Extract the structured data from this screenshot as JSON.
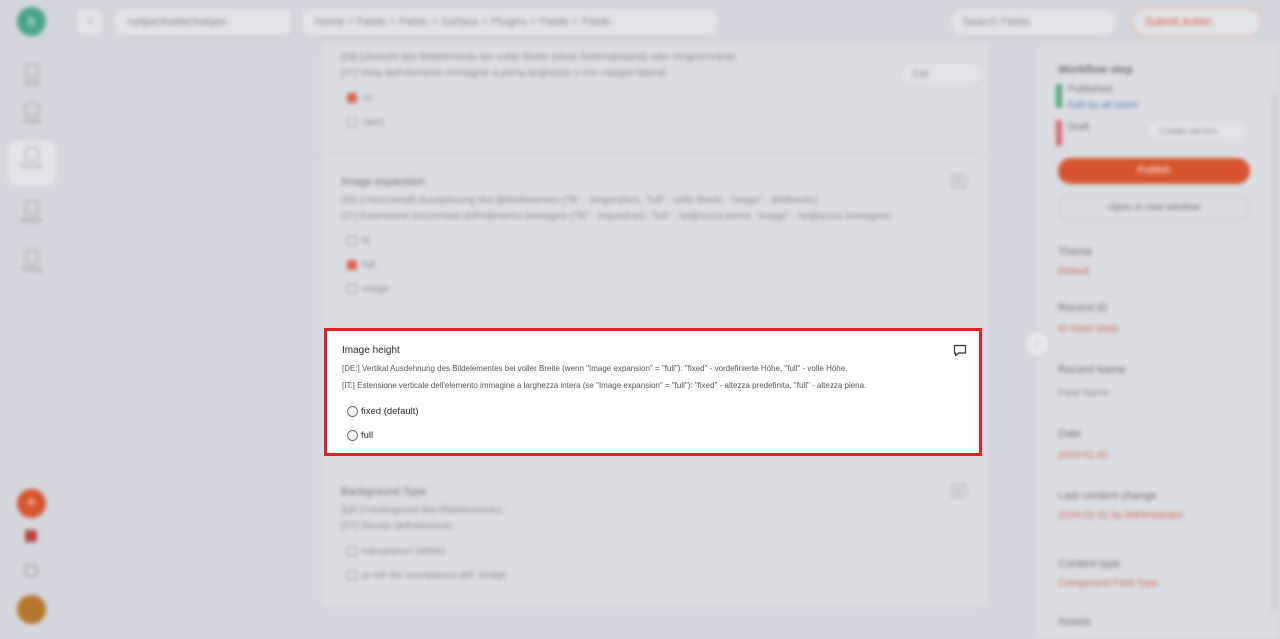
{
  "app": {
    "logo_text": "h",
    "breadcrumb_project": "neitperthattechatges",
    "breadcrumb_path": "Home > Fields > Fields > Surface > Plugins > Fields > Fields",
    "search_placeholder": "Search Fields",
    "top_right_button": "Submit Action"
  },
  "rail": {
    "items": [
      {
        "label": "Home"
      },
      {
        "label": "Assets"
      },
      {
        "label": "Records"
      },
      {
        "label": "Reports"
      },
      {
        "label": "Settings"
      }
    ],
    "avatar_initials": "R"
  },
  "background_fields": [
    {
      "desc_de": "[DE:] Ansicht des Bildelements bei voller Breite (ohne Seitenabstand) oder eingeschränkt",
      "desc_it": "[IT:] Vista dell'elemento immagine a piena larghezza o con margini laterali",
      "action_label": "Edit",
      "options": [
        {
          "label": "on",
          "checked": true
        },
        {
          "label": "open",
          "checked": false
        }
      ]
    },
    {
      "title": "Image expansion",
      "desc_de": "[DE:] Horizontale Ausdehnung des Bildelementes (\"fit\" - eingerahmt, \"full\" - volle Breite, \"image\" - Bildbreite)",
      "desc_it": "[IT:] Estensione orizzontale dell'elemento immagine (\"fit\" - inquadrato, \"full\" - larghezza piena, \"image\" - larghezza immagine)",
      "options": [
        {
          "label": "fit",
          "checked": false
        },
        {
          "label": "full",
          "checked": true
        },
        {
          "label": "image",
          "checked": false
        }
      ]
    },
    {
      "title": "Background Type",
      "desc_de": "[DE:] Hintergrund des Bildelementes",
      "desc_it": "[IT:] Sfondo dell'elemento",
      "options": [
        {
          "label": "transparent (white)",
          "checked": false
        },
        {
          "label": "ja mit der transparent def. Image",
          "checked": false
        }
      ]
    }
  ],
  "focus_field": {
    "title": "Image height",
    "desc_de": "[DE:] Vertikal Ausdehnung des Bildelementes bei voller Breite (wenn \"Image expansion\" = \"full\"): \"fixed\" - vordefinierte Höhe, \"full\" - volle Höhe.",
    "desc_it": "[IT:] Estensione verticale dell'elemento immagine a larghezza intera (se \"Image expansion\" = \"full\"): \"fixed\" - altezza predefinita, \"full\" - altezza piena.",
    "options": [
      {
        "label": "fixed (default)",
        "checked": false
      },
      {
        "label": "full",
        "checked": false
      }
    ]
  },
  "right_panel": {
    "heading": "Workflow step",
    "status_1": "Published",
    "status_1_link": "Edit by all users",
    "status_2": "Draft",
    "status_2_action": "Create version",
    "primary_button": "Publish",
    "secondary_button": "Open in new window",
    "fields": [
      {
        "label": "Theme",
        "value": "Default"
      },
      {
        "label": "Record ID",
        "value": "ID 0000 0000"
      },
      {
        "label": "Record Name",
        "value": "Field Name"
      },
      {
        "label": "Date",
        "value": "2024-01-01"
      },
      {
        "label": "Last content change",
        "value": "2024-01-01 by Administrator"
      },
      {
        "label": "Content type",
        "value": "Component Field Type"
      },
      {
        "label": "Assets",
        "value": ""
      }
    ]
  },
  "colors": {
    "highlight_border": "#e02127",
    "accent": "#d8542e",
    "brand": "#4aa58c"
  }
}
